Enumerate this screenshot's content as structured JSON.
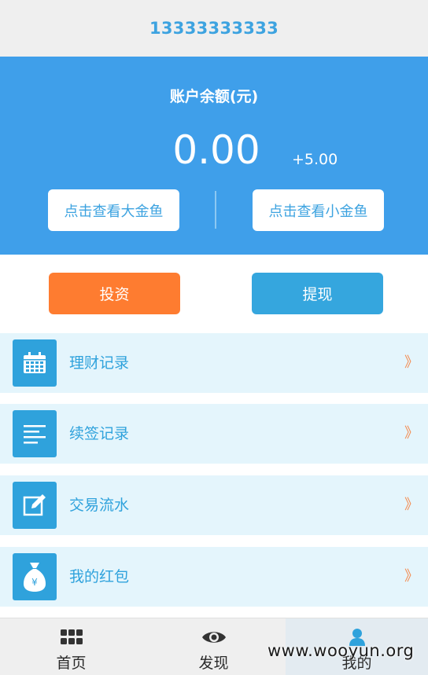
{
  "header": {
    "phone": "13333333333"
  },
  "balance": {
    "label": "账户余额(元)",
    "value": "0.00",
    "delta": "+5.00",
    "view_big_button": "点击查看大金鱼",
    "view_small_button": "点击查看小金鱼",
    "accent_color": "#3f9fea"
  },
  "actions": {
    "invest_label": "投资",
    "invest_color": "#fe7c30",
    "withdraw_label": "提现",
    "withdraw_color": "#35a6de"
  },
  "menu": {
    "items": [
      {
        "label": "理财记录",
        "icon": "calendar-icon",
        "chevron": "》"
      },
      {
        "label": "续签记录",
        "icon": "list-lines-icon",
        "chevron": "》"
      },
      {
        "label": "交易流水",
        "icon": "edit-icon",
        "chevron": "》"
      },
      {
        "label": "我的红包",
        "icon": "money-bag-icon",
        "chevron": "》"
      }
    ]
  },
  "tabbar": {
    "tabs": [
      {
        "label": "首页",
        "icon": "grid-icon",
        "active": false
      },
      {
        "label": "发现",
        "icon": "eye-icon",
        "active": false
      },
      {
        "label": "我的",
        "icon": "user-icon",
        "active": true
      }
    ]
  },
  "watermark": "www.wooyun.org"
}
